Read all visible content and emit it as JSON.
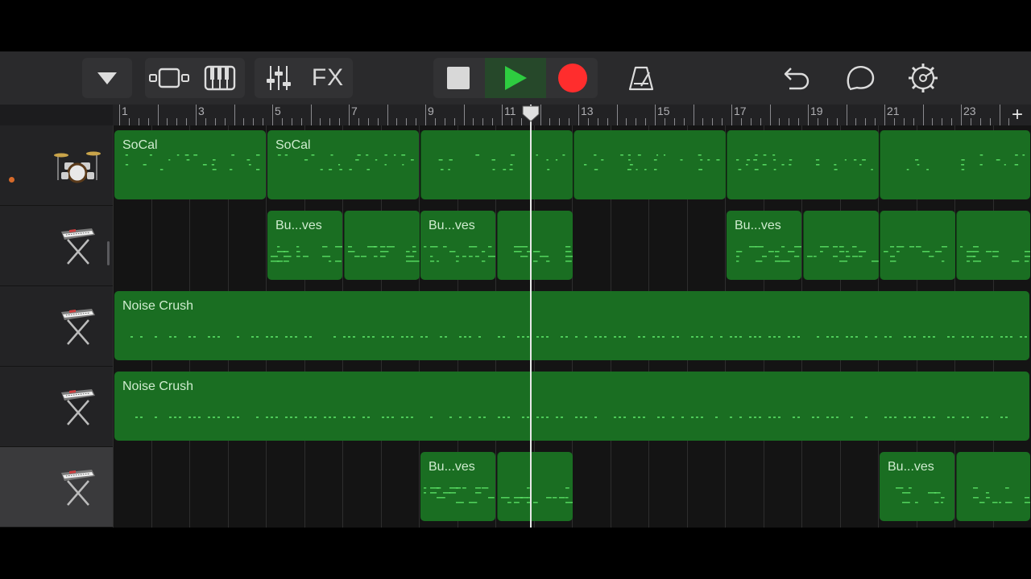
{
  "colors": {
    "background": "#1c1c1e",
    "toolbar": "#2a2a2c",
    "region_green": "#1a6e22",
    "note_green": "#5fe86a",
    "play_green": "#2ecc40",
    "record_red": "#ff2d2d",
    "playhead": "#e8e8e8"
  },
  "toolbar": {
    "browser_icon": "triangle-down-icon",
    "view_icon": "tracks-view-icon",
    "keyboard_icon": "piano-keys-icon",
    "mixer_icon": "sliders-icon",
    "fx_label": "FX",
    "stop_icon": "stop-icon",
    "play_icon": "play-icon",
    "record_icon": "record-icon",
    "metronome_icon": "metronome-icon",
    "undo_icon": "undo-icon",
    "loop_icon": "loop-browser-icon",
    "settings_icon": "gear-icon"
  },
  "ruler": {
    "bar_numbers": [
      "1",
      "3",
      "5",
      "7",
      "9",
      "11",
      "13",
      "15",
      "17",
      "19",
      "21",
      "23"
    ],
    "add_label": "+",
    "playhead_bar": 11.75
  },
  "tracks": [
    {
      "instrument_icon": "drum-kit-icon",
      "record_armed": true,
      "selected": false,
      "regions": [
        {
          "label": "SoCal",
          "start": 1,
          "end": 5,
          "style": "drum"
        },
        {
          "label": "SoCal",
          "start": 5,
          "end": 9,
          "style": "drum"
        },
        {
          "label": "",
          "start": 9,
          "end": 13,
          "style": "drum"
        },
        {
          "label": "",
          "start": 13,
          "end": 17,
          "style": "drum"
        },
        {
          "label": "",
          "start": 17,
          "end": 21,
          "style": "drum"
        },
        {
          "label": "",
          "start": 21,
          "end": 25,
          "style": "drum"
        }
      ]
    },
    {
      "instrument_icon": "keyboard-stand-icon",
      "record_armed": false,
      "selected": false,
      "regions": [
        {
          "label": "Bu...ves",
          "start": 5,
          "end": 7,
          "style": "chord"
        },
        {
          "label": "",
          "start": 7,
          "end": 9,
          "style": "chord"
        },
        {
          "label": "Bu...ves",
          "start": 9,
          "end": 11,
          "style": "chord"
        },
        {
          "label": "",
          "start": 11,
          "end": 13,
          "style": "chord"
        },
        {
          "label": "Bu...ves",
          "start": 17,
          "end": 19,
          "style": "chord"
        },
        {
          "label": "",
          "start": 19,
          "end": 21,
          "style": "chord"
        },
        {
          "label": "",
          "start": 21,
          "end": 23,
          "style": "chord"
        },
        {
          "label": "",
          "start": 23,
          "end": 25,
          "style": "chord"
        }
      ]
    },
    {
      "instrument_icon": "keyboard-stand-icon",
      "record_armed": false,
      "selected": false,
      "regions": [
        {
          "label": "Noise Crush",
          "start": 1,
          "end": 25,
          "style": "dots"
        }
      ]
    },
    {
      "instrument_icon": "keyboard-stand-icon",
      "record_armed": false,
      "selected": false,
      "regions": [
        {
          "label": "Noise Crush",
          "start": 1,
          "end": 25,
          "style": "dots"
        }
      ]
    },
    {
      "instrument_icon": "keyboard-stand-icon",
      "record_armed": false,
      "selected": true,
      "regions": [
        {
          "label": "Bu...ves",
          "start": 9,
          "end": 11,
          "style": "chord"
        },
        {
          "label": "",
          "start": 11,
          "end": 13,
          "style": "chord"
        },
        {
          "label": "Bu...ves",
          "start": 21,
          "end": 23,
          "style": "chord"
        },
        {
          "label": "",
          "start": 23,
          "end": 25,
          "style": "chord"
        }
      ]
    }
  ]
}
